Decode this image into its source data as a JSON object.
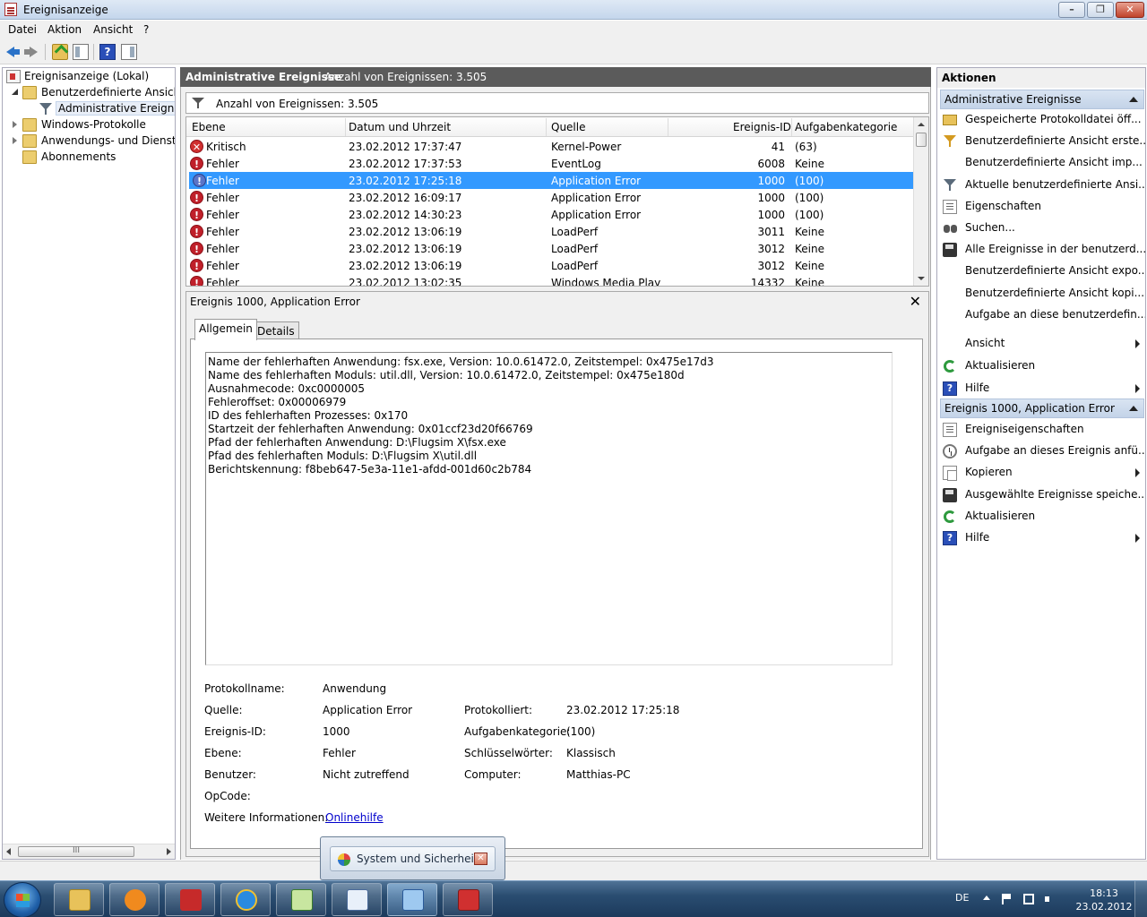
{
  "window": {
    "title": "Ereignisanzeige"
  },
  "menu": [
    "Datei",
    "Aktion",
    "Ansicht",
    "?"
  ],
  "tree": {
    "items": [
      {
        "label": "Ereignisanzeige (Lokal)",
        "icon": "computer-icon"
      },
      {
        "label": "Benutzerdefinierte Ansichten",
        "icon": "folder-icon"
      },
      {
        "label": "Administrative Ereignisse",
        "icon": "filter-icon"
      },
      {
        "label": "Windows-Protokolle",
        "icon": "folder-icon"
      },
      {
        "label": "Anwendungs- und Dienstprotokolle",
        "icon": "folder-icon"
      },
      {
        "label": "Abonnements",
        "icon": "folder-icon"
      }
    ],
    "scroll_grip": "III"
  },
  "center": {
    "header_title": "Administrative Ereignisse",
    "header_count": "Anzahl von Ereignissen: 3.505",
    "filter_text": "Anzahl von Ereignissen: 3.505",
    "columns": [
      "Ebene",
      "Datum und Uhrzeit",
      "Quelle",
      "Ereignis-ID",
      "Aufgabenkategorie"
    ],
    "rows": [
      {
        "level": "Kritisch",
        "date": "23.02.2012 17:37:47",
        "source": "Kernel-Power",
        "id": "41",
        "category": "(63)",
        "selected": false
      },
      {
        "level": "Fehler",
        "date": "23.02.2012 17:37:53",
        "source": "EventLog",
        "id": "6008",
        "category": "Keine",
        "selected": false
      },
      {
        "level": "Fehler",
        "date": "23.02.2012 17:25:18",
        "source": "Application Error",
        "id": "1000",
        "category": "(100)",
        "selected": true
      },
      {
        "level": "Fehler",
        "date": "23.02.2012 16:09:17",
        "source": "Application Error",
        "id": "1000",
        "category": "(100)",
        "selected": false
      },
      {
        "level": "Fehler",
        "date": "23.02.2012 14:30:23",
        "source": "Application Error",
        "id": "1000",
        "category": "(100)",
        "selected": false
      },
      {
        "level": "Fehler",
        "date": "23.02.2012 13:06:19",
        "source": "LoadPerf",
        "id": "3011",
        "category": "Keine",
        "selected": false
      },
      {
        "level": "Fehler",
        "date": "23.02.2012 13:06:19",
        "source": "LoadPerf",
        "id": "3012",
        "category": "Keine",
        "selected": false
      },
      {
        "level": "Fehler",
        "date": "23.02.2012 13:06:19",
        "source": "LoadPerf",
        "id": "3012",
        "category": "Keine",
        "selected": false
      },
      {
        "level": "Fehler",
        "date": "23.02.2012 13:02:35",
        "source": "Windows Media Play",
        "id": "14332",
        "category": "Keine",
        "selected": false
      }
    ]
  },
  "detail": {
    "title": "Ereignis 1000, Application Error",
    "close_glyph": "✕",
    "tabs": [
      "Allgemein",
      "Details"
    ],
    "description": [
      "Name der fehlerhaften Anwendung: fsx.exe, Version: 10.0.61472.0, Zeitstempel: 0x475e17d3",
      "Name des fehlerhaften Moduls: util.dll, Version: 10.0.61472.0, Zeitstempel: 0x475e180d",
      "Ausnahmecode: 0xc0000005",
      "Fehleroffset: 0x00006979",
      "ID des fehlerhaften Prozesses: 0x170",
      "Startzeit der fehlerhaften Anwendung: 0x01ccf23d20f66769",
      "Pfad der fehlerhaften Anwendung: D:\\Flugsim X\\fsx.exe",
      "Pfad des fehlerhaften Moduls: D:\\Flugsim X\\util.dll",
      "Berichtskennung: f8beb647-5e3a-11e1-afdd-001d60c2b784"
    ],
    "props": {
      "logname_label": "Protokollname:",
      "logname": "Anwendung",
      "source_label": "Quelle:",
      "source": "Application Error",
      "logged_label": "Protokolliert:",
      "logged": "23.02.2012 17:25:18",
      "eventid_label": "Ereignis-ID:",
      "eventid": "1000",
      "taskcat_label": "Aufgabenkategorie:",
      "taskcat": "(100)",
      "level_label": "Ebene:",
      "level": "Fehler",
      "keywords_label": "Schlüsselwörter:",
      "keywords": "Klassisch",
      "user_label": "Benutzer:",
      "user": "Nicht zutreffend",
      "computer_label": "Computer:",
      "computer": "Matthias-PC",
      "opcode_label": "OpCode:",
      "moreinfo_label": "Weitere Informationen:",
      "moreinfo_link": "Onlinehilfe"
    }
  },
  "actions": {
    "title": "Aktionen",
    "section1": {
      "title": "Administrative Ereignisse",
      "items": [
        {
          "label": "Gespeicherte Protokolldatei öff...",
          "icon": "folder-icon",
          "submenu": false
        },
        {
          "label": "Benutzerdefinierte Ansicht erste...",
          "icon": "filter-add-icon",
          "submenu": false
        },
        {
          "label": "Benutzerdefinierte Ansicht imp...",
          "icon": "",
          "submenu": false
        },
        {
          "label": "Aktuelle benutzerdefinierte Ansi...",
          "icon": "filter-icon",
          "submenu": false
        },
        {
          "label": "Eigenschaften",
          "icon": "properties-icon",
          "submenu": false
        },
        {
          "label": "Suchen...",
          "icon": "binoculars-icon",
          "submenu": false
        },
        {
          "label": "Alle Ereignisse in der benutzerd...",
          "icon": "save-icon",
          "submenu": false
        },
        {
          "label": "Benutzerdefinierte Ansicht expo...",
          "icon": "",
          "submenu": false
        },
        {
          "label": "Benutzerdefinierte Ansicht kopi...",
          "icon": "",
          "submenu": false
        },
        {
          "label": "Aufgabe an diese benutzerdefin...",
          "icon": "",
          "submenu": false
        },
        {
          "label": "Ansicht",
          "icon": "",
          "submenu": true
        },
        {
          "label": "Aktualisieren",
          "icon": "refresh-icon",
          "submenu": false
        },
        {
          "label": "Hilfe",
          "icon": "help-icon",
          "submenu": true
        }
      ]
    },
    "section2": {
      "title": "Ereignis 1000, Application Error",
      "items": [
        {
          "label": "Ereigniseigenschaften",
          "icon": "properties-icon",
          "submenu": false
        },
        {
          "label": "Aufgabe an dieses Ereignis anfü...",
          "icon": "task-icon",
          "submenu": false
        },
        {
          "label": "Kopieren",
          "icon": "copy-icon",
          "submenu": true
        },
        {
          "label": "Ausgewählte Ereignisse speiche...",
          "icon": "save-icon",
          "submenu": false
        },
        {
          "label": "Aktualisieren",
          "icon": "refresh-icon",
          "submenu": false
        },
        {
          "label": "Hilfe",
          "icon": "help-icon",
          "submenu": true
        }
      ]
    }
  },
  "taskbar": {
    "popup_label": "System und Sicherheit",
    "lang": "DE",
    "time": "18:13",
    "date": "23.02.2012",
    "apps": [
      "explorer-icon",
      "media-player-icon",
      "mp3-converter-icon",
      "internet-explorer-icon",
      "notepad-icon",
      "wordpad-icon",
      "control-panel-icon",
      "toolbox-icon"
    ]
  }
}
